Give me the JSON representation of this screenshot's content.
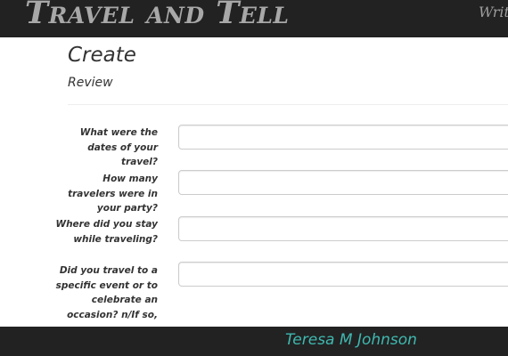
{
  "navbar": {
    "brand": "Travel and Tell",
    "link_write": "Write"
  },
  "header": {
    "title": "Create",
    "subtitle": "Review"
  },
  "form": {
    "fields": [
      {
        "label": "What were the dates of your travel?",
        "value": "",
        "placeholder": ""
      },
      {
        "label": "How many travelers were in your party?",
        "value": "",
        "placeholder": ""
      },
      {
        "label": "Where did you stay while traveling?",
        "value": "",
        "placeholder": ""
      },
      {
        "label": "Did you travel to a specific event or to celebrate an occasion? n/If so,",
        "value": "",
        "placeholder": ""
      }
    ]
  },
  "footer": {
    "author": "Teresa M Johnson"
  },
  "colors": {
    "navbar_bg": "#222222",
    "brand_text": "#a8a8a8",
    "footer_text": "#3fb8b0"
  }
}
